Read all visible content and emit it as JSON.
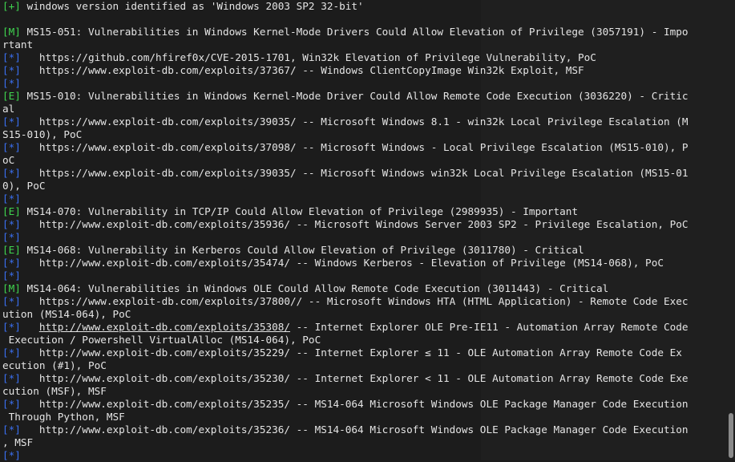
{
  "terminal": {
    "lines": [
      {
        "tag": "[+]",
        "kind": "plus",
        "text": " windows version identified as 'Windows 2003 SP2 32-bit'"
      },
      {
        "tag": "",
        "kind": "none",
        "text": ""
      },
      {
        "tag": "[M]",
        "kind": "m",
        "text": " MS15-051: Vulnerabilities in Windows Kernel-Mode Drivers Could Allow Elevation of Privilege (3057191) - Impo"
      },
      {
        "tag": "",
        "kind": "none",
        "text": "rtant"
      },
      {
        "tag": "[*]",
        "kind": "star",
        "text": "   https://github.com/hfiref0x/CVE-2015-1701, Win32k Elevation of Privilege Vulnerability, PoC"
      },
      {
        "tag": "[*]",
        "kind": "star",
        "text": "   https://www.exploit-db.com/exploits/37367/ -- Windows ClientCopyImage Win32k Exploit, MSF"
      },
      {
        "tag": "[*]",
        "kind": "star",
        "text": ""
      },
      {
        "tag": "[E]",
        "kind": "e",
        "text": " MS15-010: Vulnerabilities in Windows Kernel-Mode Driver Could Allow Remote Code Execution (3036220) - Critic"
      },
      {
        "tag": "",
        "kind": "none",
        "text": "al"
      },
      {
        "tag": "[*]",
        "kind": "star",
        "text": "   https://www.exploit-db.com/exploits/39035/ -- Microsoft Windows 8.1 - win32k Local Privilege Escalation (M"
      },
      {
        "tag": "",
        "kind": "none",
        "text": "S15-010), PoC"
      },
      {
        "tag": "[*]",
        "kind": "star",
        "text": "   https://www.exploit-db.com/exploits/37098/ -- Microsoft Windows - Local Privilege Escalation (MS15-010), P"
      },
      {
        "tag": "",
        "kind": "none",
        "text": "oC"
      },
      {
        "tag": "[*]",
        "kind": "star",
        "text": "   https://www.exploit-db.com/exploits/39035/ -- Microsoft Windows win32k Local Privilege Escalation (MS15-01"
      },
      {
        "tag": "",
        "kind": "none",
        "text": "0), PoC"
      },
      {
        "tag": "[*]",
        "kind": "star",
        "text": ""
      },
      {
        "tag": "[E]",
        "kind": "e",
        "text": " MS14-070: Vulnerability in TCP/IP Could Allow Elevation of Privilege (2989935) - Important"
      },
      {
        "tag": "[*]",
        "kind": "star",
        "text": "   http://www.exploit-db.com/exploits/35936/ -- Microsoft Windows Server 2003 SP2 - Privilege Escalation, PoC"
      },
      {
        "tag": "[*]",
        "kind": "star",
        "text": ""
      },
      {
        "tag": "[E]",
        "kind": "e",
        "text": " MS14-068: Vulnerability in Kerberos Could Allow Elevation of Privilege (3011780) - Critical"
      },
      {
        "tag": "[*]",
        "kind": "star",
        "text": "   http://www.exploit-db.com/exploits/35474/ -- Windows Kerberos - Elevation of Privilege (MS14-068), PoC"
      },
      {
        "tag": "[*]",
        "kind": "star",
        "text": ""
      },
      {
        "tag": "[M]",
        "kind": "m",
        "text": " MS14-064: Vulnerabilities in Windows OLE Could Allow Remote Code Execution (3011443) - Critical"
      },
      {
        "tag": "[*]",
        "kind": "star",
        "text": "   https://www.exploit-db.com/exploits/37800// -- Microsoft Windows HTA (HTML Application) - Remote Code Exec"
      },
      {
        "tag": "",
        "kind": "none",
        "text": "ution (MS14-064), PoC"
      },
      {
        "tag": "[*]",
        "kind": "star",
        "text": "   http://www.exploit-db.com/exploits/35308/ -- Internet Explorer OLE Pre-IE11 - Automation Array Remote Code"
      },
      {
        "tag": "",
        "kind": "none",
        "text": " Execution / Powershell VirtualAlloc (MS14-064), PoC"
      },
      {
        "tag": "[*]",
        "kind": "star",
        "text": "   http://www.exploit-db.com/exploits/35229/ -- Internet Explorer ≤ 11 - OLE Automation Array Remote Code Ex"
      },
      {
        "tag": "",
        "kind": "none",
        "text": "ecution (#1), PoC"
      },
      {
        "tag": "[*]",
        "kind": "star",
        "text": "   http://www.exploit-db.com/exploits/35230/ -- Internet Explorer < 11 - OLE Automation Array Remote Code Exe"
      },
      {
        "tag": "",
        "kind": "none",
        "text": "cution (MSF), MSF"
      },
      {
        "tag": "[*]",
        "kind": "star",
        "text": "   http://www.exploit-db.com/exploits/35235/ -- MS14-064 Microsoft Windows OLE Package Manager Code Execution"
      },
      {
        "tag": "",
        "kind": "none",
        "text": " Through Python, MSF"
      },
      {
        "tag": "[*]",
        "kind": "star",
        "text": "   http://www.exploit-db.com/exploits/35236/ -- MS14-064 Microsoft Windows OLE Package Manager Code Execution"
      },
      {
        "tag": "",
        "kind": "none",
        "text": ", MSF"
      },
      {
        "tag": "[*]",
        "kind": "star",
        "text": ""
      }
    ]
  },
  "colors": {
    "background": "#1c1c1c",
    "text": "#e4e4e4",
    "tag_green": "#3fd44f",
    "tag_blue": "#3a6ff0"
  }
}
